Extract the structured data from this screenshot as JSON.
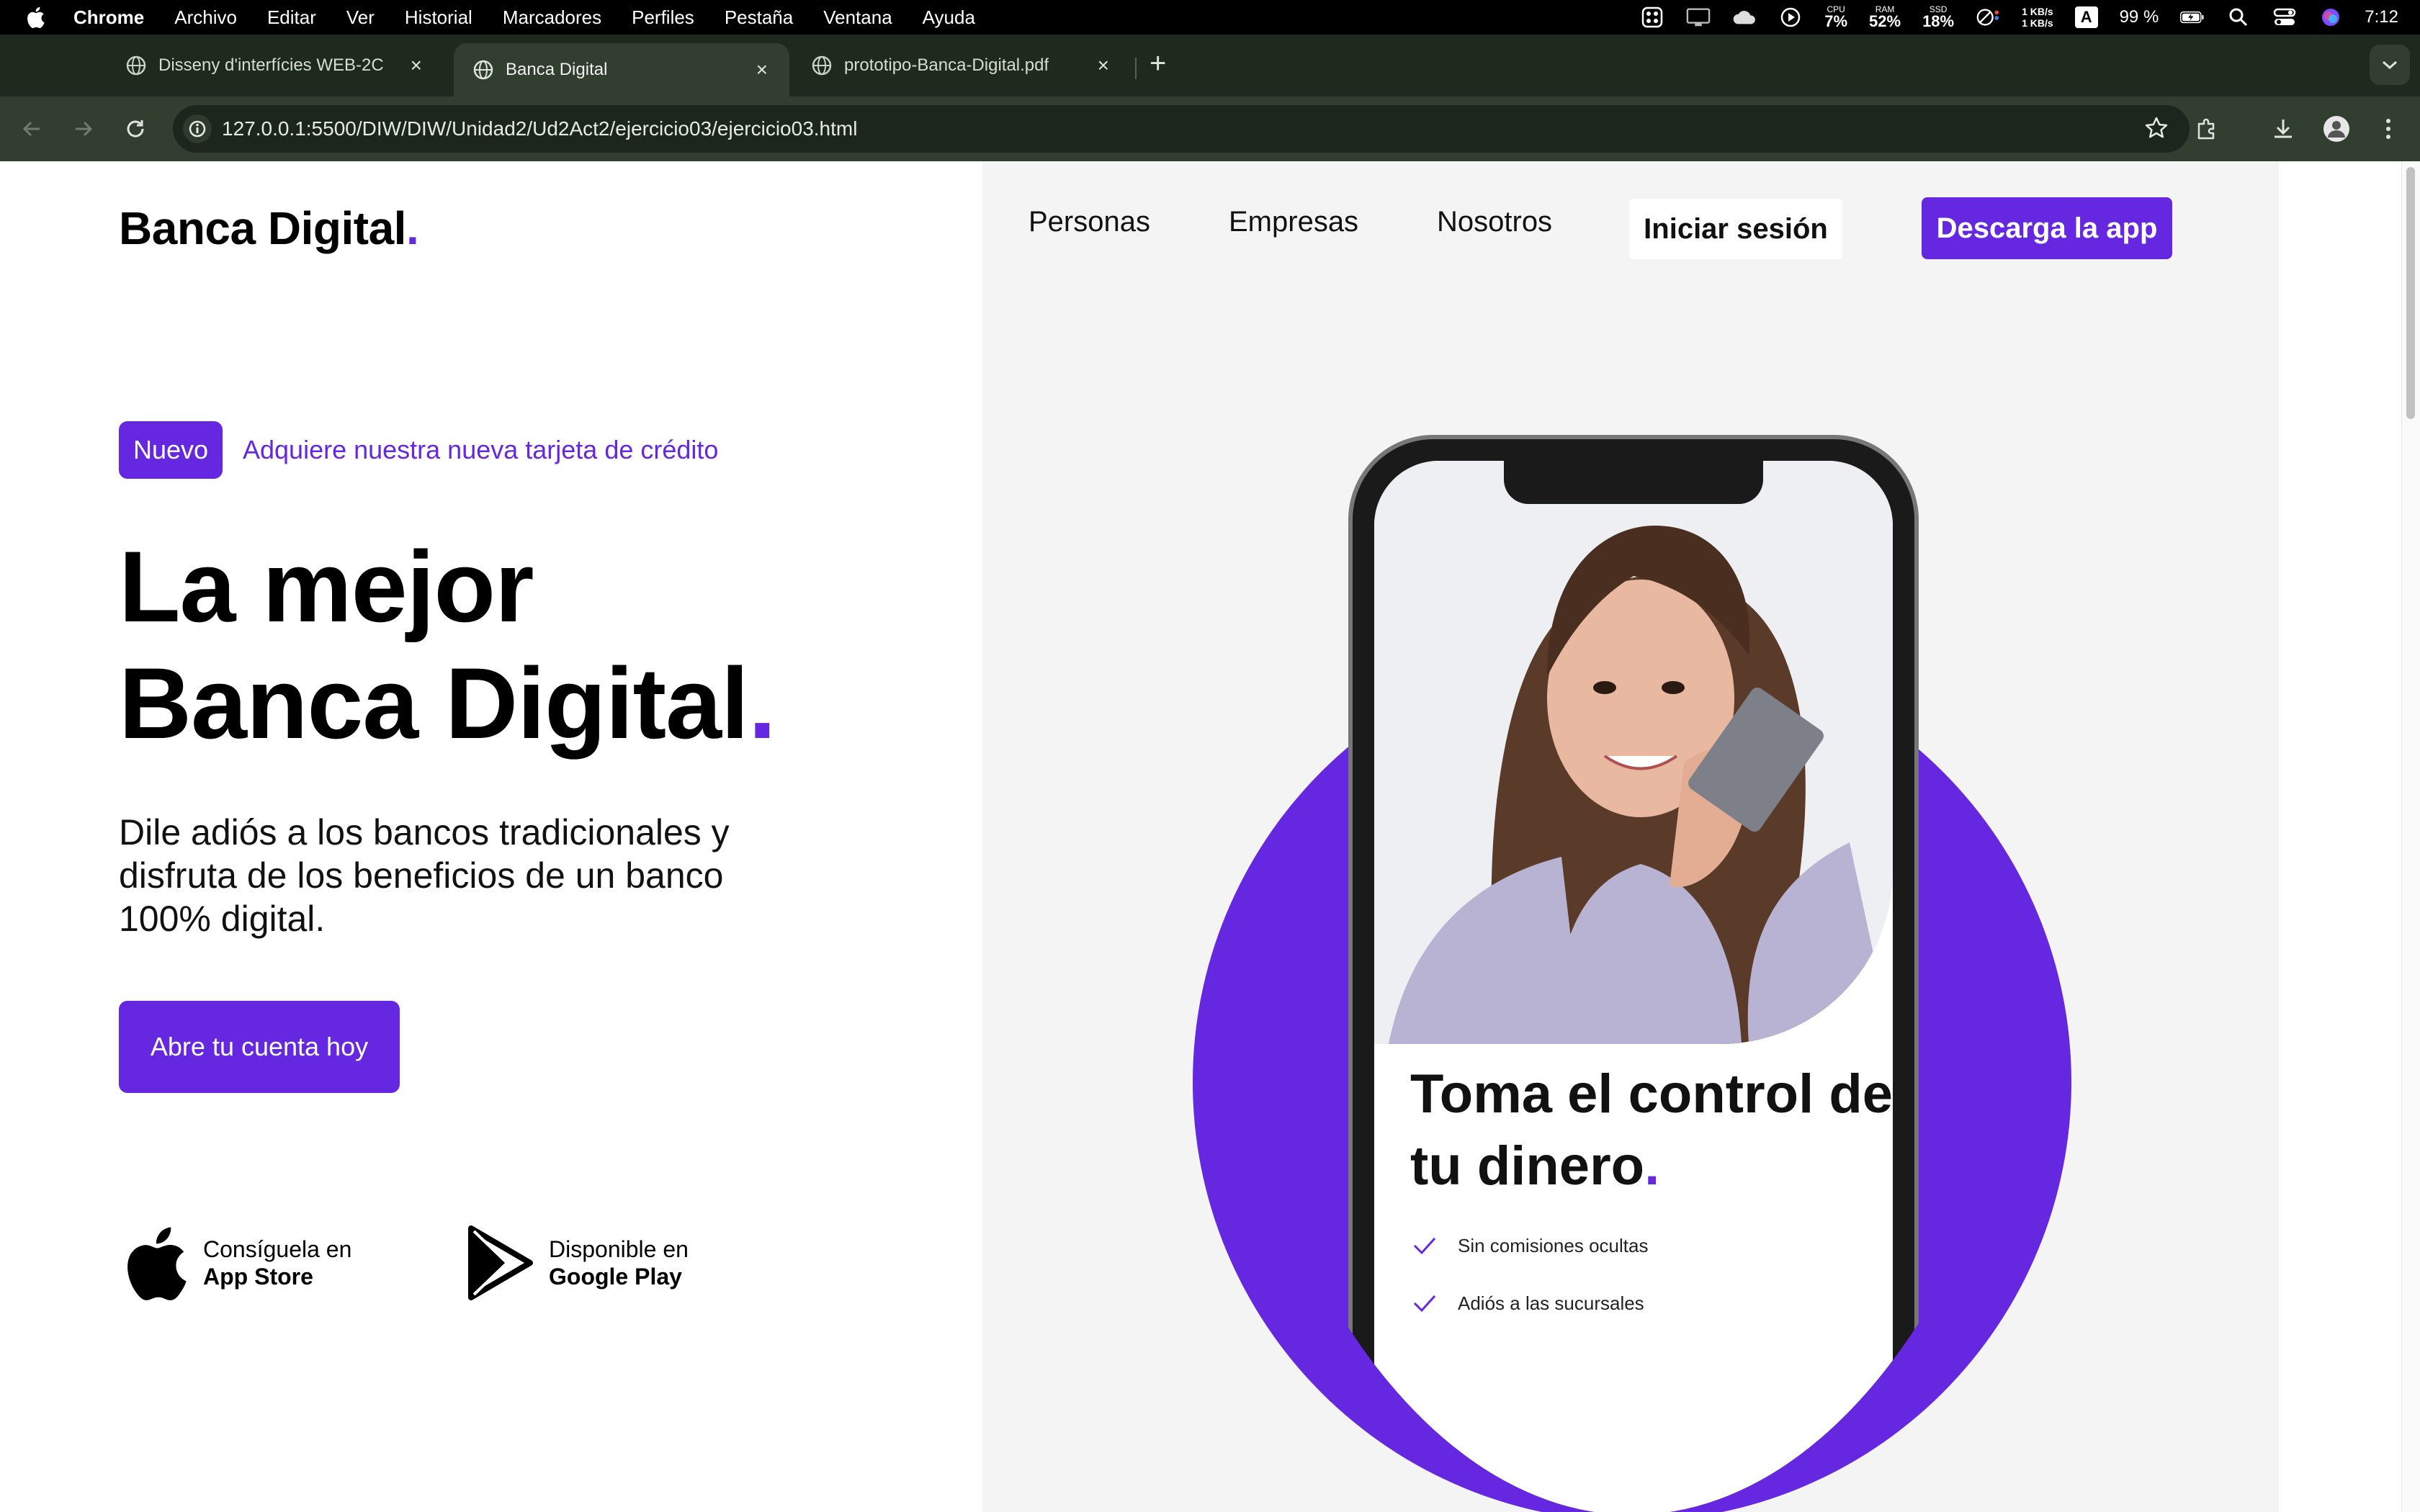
{
  "menubar": {
    "app_name": "Chrome",
    "items": [
      "Archivo",
      "Editar",
      "Ver",
      "Historial",
      "Marcadores",
      "Perfiles",
      "Pestaña",
      "Ventana",
      "Ayuda"
    ],
    "cpu_label": "CPU",
    "cpu_value": "7%",
    "ram_label": "RAM",
    "ram_value": "52%",
    "ssd_label": "SSD",
    "ssd_value": "18%",
    "net_up": "1 KB/s",
    "net_down": "1 KB/s",
    "input_source": "A",
    "battery": "99 %",
    "clock": "7:12"
  },
  "tabs": [
    {
      "title": "Disseny d'interfícies WEB-2C",
      "close": "×"
    },
    {
      "title": "Banca Digital",
      "close": "×"
    },
    {
      "title": "prototipo-Banca-Digital.pdf",
      "close": "×"
    }
  ],
  "newtab_label": "+",
  "omnibox": {
    "url": "127.0.0.1:5500/DIW/DIW/Unidad2/Ud2Act2/ejercicio03/ejercicio03.html"
  },
  "site": {
    "logo": "Banca Digital",
    "logo_dot": ".",
    "nav": [
      "Personas",
      "Empresas",
      "Nosotros"
    ],
    "login_label": "Iniciar sesión",
    "download_label": "Descarga la app",
    "badge": "Nuevo",
    "badge_text": "Adquiere nuestra nueva tarjeta de crédito",
    "hero_line1": "La mejor",
    "hero_line2": "Banca Digital",
    "hero_dot": ".",
    "hero_sub": "Dile adiós a los bancos tradicionales y disfruta de los beneficios de un banco 100% digital.",
    "cta": "Abre tu cuenta hoy",
    "appstore_small": "Consíguela en",
    "appstore_big": "App Store",
    "play_small": "Disponible en",
    "play_big": "Google Play"
  },
  "phone_screen": {
    "title": "Toma el control de tu dinero",
    "title_dot": ".",
    "features": [
      "Sin comisiones ocultas",
      "Adiós a las sucursales"
    ]
  },
  "colors": {
    "brand": "#6528e0",
    "panel": "#f4f4f4",
    "chrome_tabs": "#1e2a1e",
    "chrome_toolbar": "#323f30"
  }
}
